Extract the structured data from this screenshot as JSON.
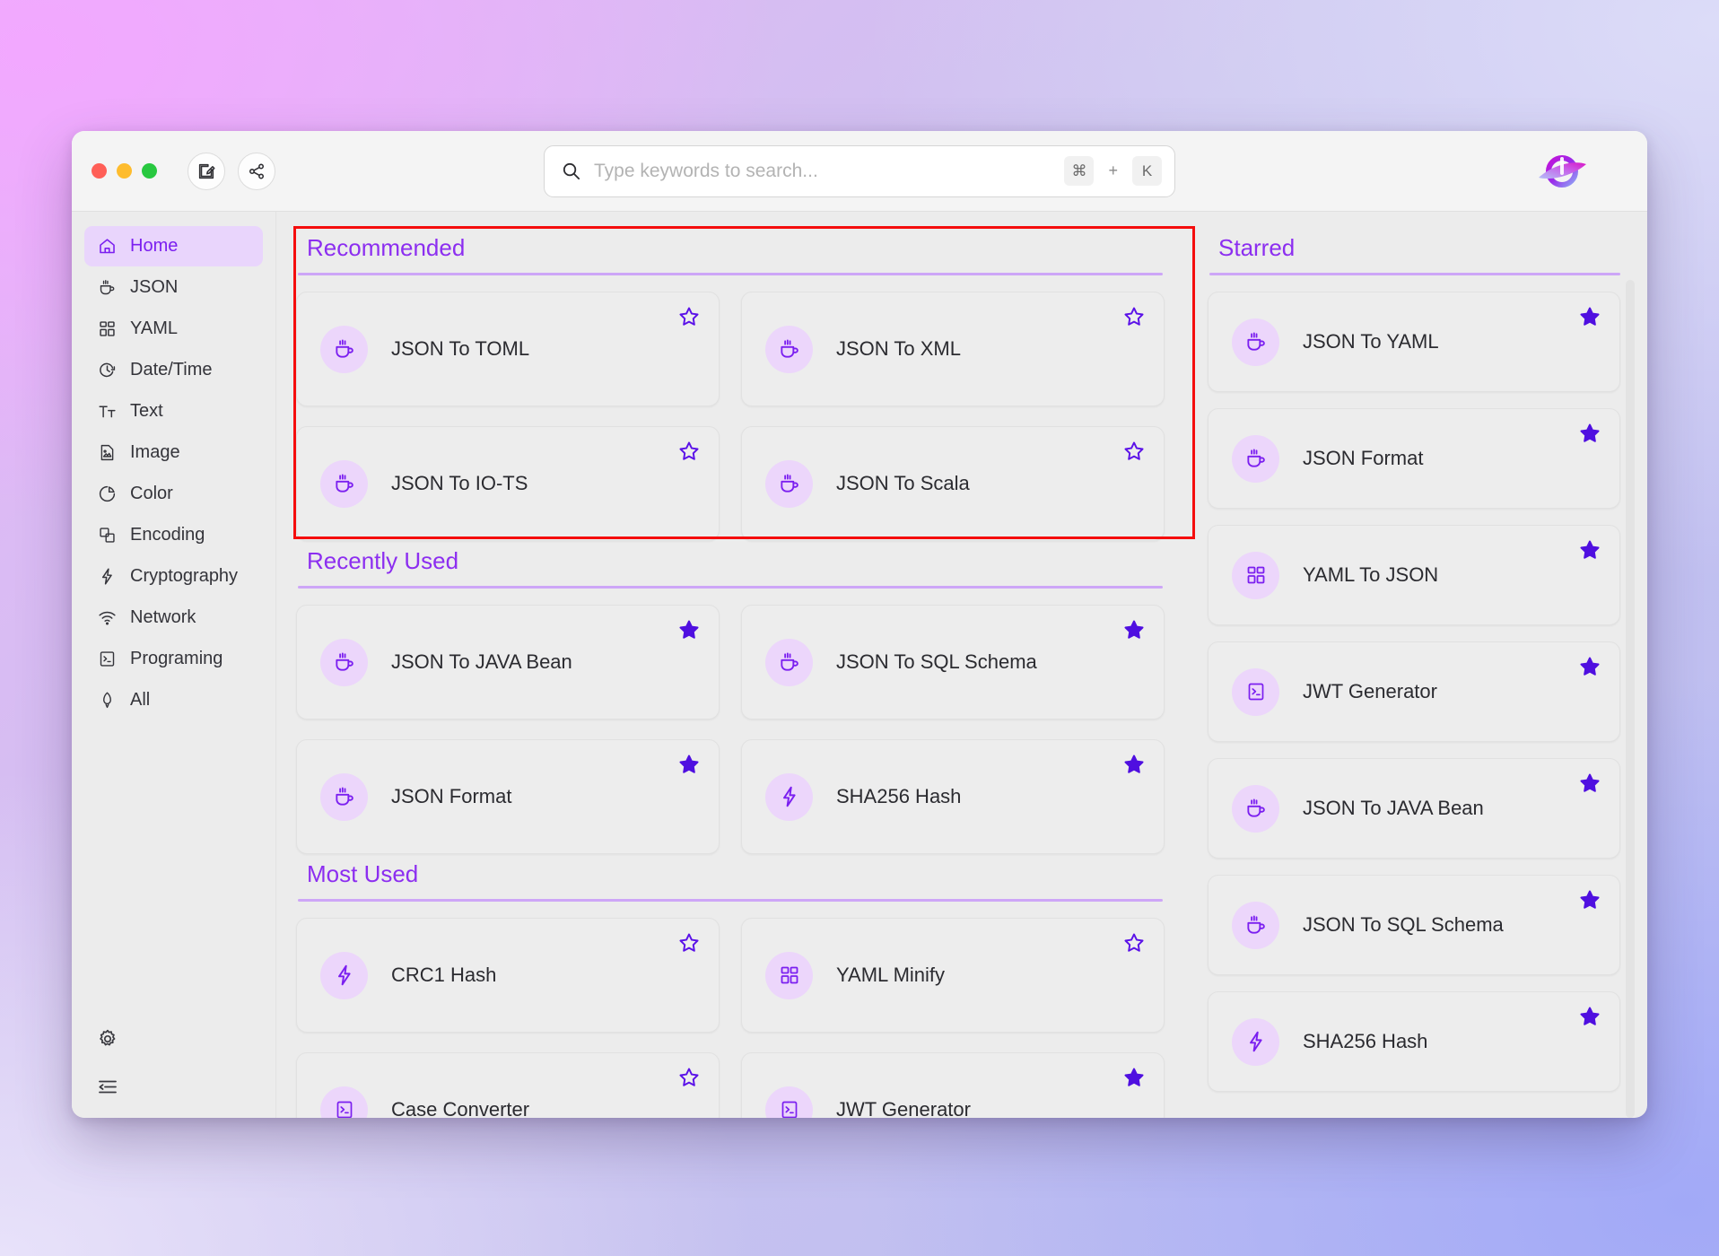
{
  "window": {
    "traffic_lights": [
      {
        "name": "close",
        "color": "#ff5f57"
      },
      {
        "name": "minimize",
        "color": "#febc2e"
      },
      {
        "name": "maximize",
        "color": "#28c840"
      }
    ],
    "toolbar_buttons": [
      {
        "name": "edit-icon",
        "label": "Edit"
      },
      {
        "name": "share-icon",
        "label": "Share"
      }
    ],
    "logo_name": "app-logo"
  },
  "search": {
    "placeholder": "Type keywords to search...",
    "value": "",
    "icon": "search-icon",
    "shortcut_modifier": "⌘",
    "shortcut_plus": "+",
    "shortcut_key": "K"
  },
  "sidebar": {
    "items": [
      {
        "label": "Home",
        "icon": "home-icon",
        "active": true
      },
      {
        "label": "JSON",
        "icon": "coffee-cup-icon",
        "active": false
      },
      {
        "label": "YAML",
        "icon": "grid-icon",
        "active": false
      },
      {
        "label": "Date/Time",
        "icon": "clock-icon",
        "active": false
      },
      {
        "label": "Text",
        "icon": "text-size-icon",
        "active": false
      },
      {
        "label": "Image",
        "icon": "image-icon",
        "active": false
      },
      {
        "label": "Color",
        "icon": "pie-chart-icon",
        "active": false
      },
      {
        "label": "Encoding",
        "icon": "layers-icon",
        "active": false
      },
      {
        "label": "Cryptography",
        "icon": "lightning-icon",
        "active": false
      },
      {
        "label": "Network",
        "icon": "wifi-icon",
        "active": false
      },
      {
        "label": "Programing",
        "icon": "terminal-icon",
        "active": false
      },
      {
        "label": "All",
        "icon": "rocket-icon",
        "active": false
      }
    ],
    "footer_icons": [
      {
        "name": "gear-icon",
        "label": "Settings"
      },
      {
        "name": "collapse-sidebar-icon",
        "label": "Collapse"
      }
    ]
  },
  "colors": {
    "accent_purple": "#7b1ff0",
    "heading_purple": "#8c2ef0",
    "rule_purple": "#cda6f7",
    "active_pill": "#e9d5fc",
    "icon_bubble": "#ecd6fb",
    "annotation_red": "#f50d0d",
    "card_bg": "#ededed"
  },
  "sections": {
    "recommended": {
      "title": "Recommended",
      "cards": [
        {
          "label": "JSON To TOML",
          "icon": "coffee-cup-icon",
          "starred": false
        },
        {
          "label": "JSON To XML",
          "icon": "coffee-cup-icon",
          "starred": false
        },
        {
          "label": "JSON To IO-TS",
          "icon": "coffee-cup-icon",
          "starred": false
        },
        {
          "label": "JSON To Scala",
          "icon": "coffee-cup-icon",
          "starred": false
        }
      ]
    },
    "recently_used": {
      "title": "Recently Used",
      "cards": [
        {
          "label": "JSON To JAVA Bean",
          "icon": "coffee-cup-icon",
          "starred": true
        },
        {
          "label": "JSON To SQL Schema",
          "icon": "coffee-cup-icon",
          "starred": true
        },
        {
          "label": "JSON Format",
          "icon": "coffee-cup-icon",
          "starred": true
        },
        {
          "label": "SHA256 Hash",
          "icon": "lightning-icon",
          "starred": true
        }
      ]
    },
    "most_used": {
      "title": "Most Used",
      "cards": [
        {
          "label": "CRC1 Hash",
          "icon": "lightning-icon",
          "starred": false
        },
        {
          "label": "YAML Minify",
          "icon": "grid-icon",
          "starred": false
        },
        {
          "label": "Case Converter",
          "icon": "terminal-icon",
          "starred": false
        },
        {
          "label": "JWT Generator",
          "icon": "terminal-icon",
          "starred": true
        }
      ]
    },
    "starred": {
      "title": "Starred",
      "cards": [
        {
          "label": "JSON To YAML",
          "icon": "coffee-cup-icon",
          "starred": true
        },
        {
          "label": "JSON Format",
          "icon": "coffee-cup-icon",
          "starred": true
        },
        {
          "label": "YAML To JSON",
          "icon": "grid-icon",
          "starred": true
        },
        {
          "label": "JWT Generator",
          "icon": "terminal-icon",
          "starred": true
        },
        {
          "label": "JSON To JAVA Bean",
          "icon": "coffee-cup-icon",
          "starred": true
        },
        {
          "label": "JSON To SQL Schema",
          "icon": "coffee-cup-icon",
          "starred": true
        },
        {
          "label": "SHA256 Hash",
          "icon": "lightning-icon",
          "starred": true
        }
      ]
    }
  },
  "annotation": {
    "name": "recommended-section-highlight",
    "color": "#f50d0d"
  }
}
